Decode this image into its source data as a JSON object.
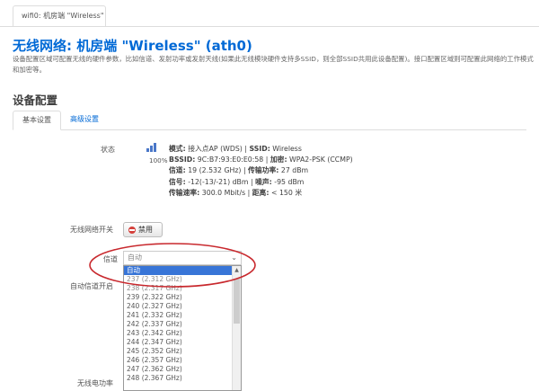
{
  "page_tab": {
    "label": "wifi0: 机房端 \"Wireless\""
  },
  "header": {
    "title": "无线网络: 机房端 \"Wireless\" (ath0)",
    "description": "设备配置区域可配置无线的硬件参数，比如信道、发射功率或发射天线(如果此无线模块硬件支持多SSID，则全部SSID共用此设备配置)。接口配置区域则可配置此网络的工作模式和加密等。"
  },
  "section": {
    "title": "设备配置",
    "tabs": [
      {
        "label": "基本设置"
      },
      {
        "label": "高级设置"
      }
    ]
  },
  "status": {
    "label": "状态",
    "signal_percent": "100%",
    "lines": [
      [
        {
          "k": "模式:",
          "v": " 接入点AP (WDS) | "
        },
        {
          "k": "SSID:",
          "v": " Wireless"
        }
      ],
      [
        {
          "k": "BSSID:",
          "v": " 9C:B7:93:E0:E0:58 | "
        },
        {
          "k": "加密:",
          "v": " WPA2-PSK (CCMP)"
        }
      ],
      [
        {
          "k": "信道:",
          "v": " 19 (2.532 GHz) | "
        },
        {
          "k": "传输功率:",
          "v": " 27 dBm"
        }
      ],
      [
        {
          "k": "信号:",
          "v": " -12(-13/-21) dBm | "
        },
        {
          "k": "噪声:",
          "v": " -95 dBm"
        }
      ],
      [
        {
          "k": "传输速率:",
          "v": " 300.0 Mbit/s | "
        },
        {
          "k": "距离:",
          "v": " < 150 米"
        }
      ]
    ]
  },
  "wireless_switch": {
    "label": "无线网络开关",
    "button_label": "禁用"
  },
  "channel": {
    "label": "信道",
    "selected_value": "自动",
    "options": [
      "自动",
      "237 (2.312 GHz)",
      "238 (2.317 GHz)",
      "239 (2.322 GHz)",
      "240 (2.327 GHz)",
      "241 (2.332 GHz)",
      "242 (2.337 GHz)",
      "243 (2.342 GHz)",
      "244 (2.347 GHz)",
      "245 (2.352 GHz)",
      "246 (2.357 GHz)",
      "247 (2.362 GHz)",
      "248 (2.367 GHz)"
    ]
  },
  "auto_channel": {
    "label": "自动信道开启"
  },
  "tx_power": {
    "label": "无线电功率"
  },
  "colors": {
    "title": "#0069d6",
    "link": "#0069d6",
    "selected_option": "#3875d7",
    "annotation": "#c8282d",
    "disable_icon": "#d43f3a"
  }
}
